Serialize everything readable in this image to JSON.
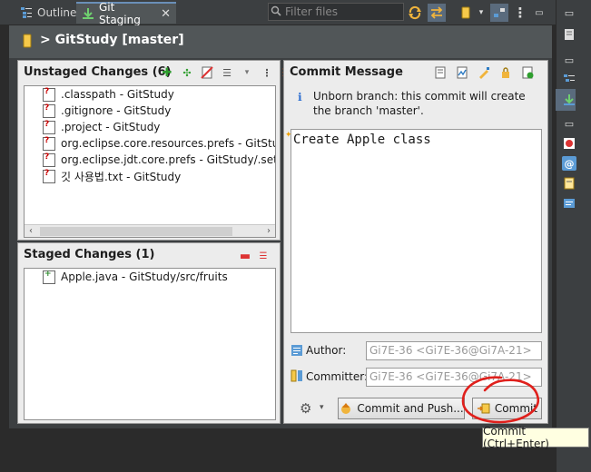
{
  "tabs": [
    {
      "label": "Outline",
      "icon": "outline-icon",
      "active": false
    },
    {
      "label": "Git Staging",
      "icon": "git-staging-icon",
      "active": true
    }
  ],
  "filter": {
    "placeholder": "Filter files"
  },
  "header": {
    "title": "> GitStudy [master]"
  },
  "unstaged": {
    "title": "Unstaged Changes (6)",
    "files": [
      ".classpath - GitStudy",
      ".gitignore - GitStudy",
      ".project - GitStudy",
      "org.eclipse.core.resources.prefs - GitStudy/.s",
      "org.eclipse.jdt.core.prefs - GitStudy/.settings",
      "깃 사용법.txt - GitStudy"
    ]
  },
  "staged": {
    "title": "Staged Changes (1)",
    "files": [
      "Apple.java - GitStudy/src/fruits"
    ]
  },
  "commit": {
    "title": "Commit Message",
    "info": "Unborn branch: this commit will create the branch 'master'.",
    "message": "Create Apple class",
    "author_label": "Author:",
    "author_value": "Gi7E-36 <Gi7E-36@Gi7A-21>",
    "committer_label": "Committer:",
    "committer_value": "Gi7E-36 <Gi7E-36@Gi7A-21>",
    "commit_push_label": "Commit and Push...",
    "commit_label": "Commit"
  },
  "tooltip": "Commit (Ctrl+Enter)",
  "colors": {
    "accent": "#6a8fb8",
    "annotation": "#e0201c"
  }
}
